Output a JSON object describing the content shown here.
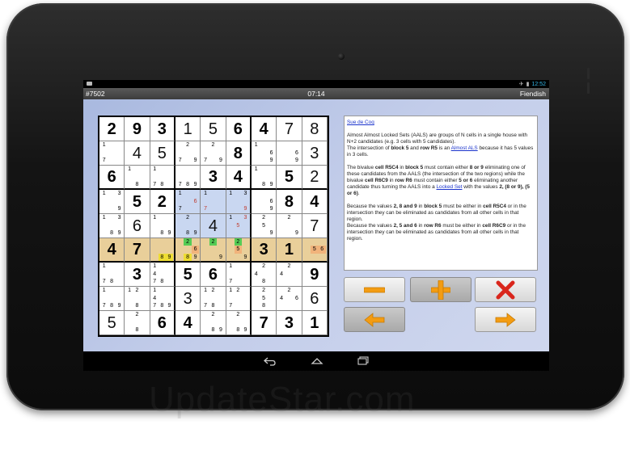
{
  "status_bar": {
    "time": "12:52"
  },
  "title_bar": {
    "puzzle_number": "#7502",
    "timer": "07:14",
    "difficulty": "Fiendish"
  },
  "board": [
    [
      "2",
      "9",
      "3",
      "1",
      "5",
      "6",
      "4",
      "7",
      "8"
    ],
    [
      "",
      "4",
      "5",
      "",
      "",
      "8",
      "",
      "",
      "3"
    ],
    [
      "6",
      "",
      "",
      "",
      "3",
      "4",
      "",
      "5",
      "2"
    ],
    [
      "",
      "5",
      "2",
      "",
      "",
      "",
      "",
      "8",
      "4"
    ],
    [
      "",
      "6",
      "",
      "",
      "4",
      "",
      "",
      "",
      "7"
    ],
    [
      "4",
      "7",
      "",
      "",
      "",
      "",
      "3",
      "1",
      ""
    ],
    [
      "",
      "3",
      "",
      "5",
      "6",
      "",
      "",
      "",
      "9"
    ],
    [
      "",
      "",
      "",
      "3",
      "",
      "",
      "",
      "",
      "6"
    ],
    [
      "5",
      "",
      "6",
      "4",
      "",
      "",
      "7",
      "3",
      "1"
    ]
  ],
  "givens": [
    [
      true,
      true,
      true,
      false,
      false,
      true,
      true,
      false,
      false
    ],
    [
      false,
      false,
      false,
      false,
      false,
      true,
      false,
      false,
      false
    ],
    [
      true,
      false,
      false,
      false,
      true,
      true,
      false,
      true,
      false
    ],
    [
      false,
      true,
      true,
      false,
      false,
      false,
      false,
      true,
      true
    ],
    [
      false,
      false,
      false,
      false,
      false,
      false,
      false,
      false,
      false
    ],
    [
      true,
      true,
      false,
      false,
      false,
      false,
      true,
      true,
      false
    ],
    [
      false,
      true,
      false,
      true,
      true,
      false,
      false,
      false,
      true
    ],
    [
      false,
      false,
      false,
      false,
      false,
      false,
      false,
      false,
      false
    ],
    [
      false,
      false,
      true,
      true,
      false,
      false,
      true,
      true,
      true
    ]
  ],
  "candidates": [
    [
      [],
      [],
      [],
      [],
      [],
      [],
      [],
      [],
      []
    ],
    [
      [
        "1",
        "",
        "",
        "",
        "",
        "",
        "7",
        "",
        ""
      ],
      [],
      [],
      [
        "",
        "2",
        "",
        "",
        "",
        "",
        "7",
        "",
        "9"
      ],
      [
        "",
        "2",
        "",
        "",
        "",
        "",
        "7",
        "",
        "9"
      ],
      [],
      [
        "1",
        "",
        "",
        "",
        "",
        "6",
        "",
        "",
        "9"
      ],
      [
        "",
        "",
        "",
        "",
        "",
        "6",
        "",
        "",
        "9"
      ],
      []
    ],
    [
      [],
      [
        "1",
        "",
        "",
        "",
        "",
        "",
        "",
        "8",
        ""
      ],
      [
        "1",
        "",
        "",
        "",
        "",
        "",
        "7",
        "8",
        ""
      ],
      [
        "",
        "",
        "",
        "",
        "",
        "",
        "7",
        "8",
        "9"
      ],
      [],
      [],
      [
        "1",
        "",
        "",
        "",
        "",
        "",
        "",
        "8",
        "9"
      ],
      [],
      []
    ],
    [
      [
        "1",
        "",
        "3",
        "",
        "",
        "",
        "",
        "",
        "9"
      ],
      [],
      [],
      [
        "1",
        "",
        "",
        "",
        "",
        "6",
        "7",
        "",
        ""
      ],
      [
        "1",
        "",
        "",
        "",
        "",
        "",
        "7",
        "",
        ""
      ],
      [
        "1",
        "",
        "3",
        "",
        "",
        "",
        "",
        "",
        "9"
      ],
      [
        "",
        "",
        "",
        "",
        "",
        "6",
        "",
        "",
        "9"
      ],
      [],
      []
    ],
    [
      [
        "1",
        "",
        "3",
        "",
        "",
        "",
        "",
        "8",
        "9"
      ],
      [],
      [
        "1",
        "",
        "",
        "",
        "",
        "",
        "",
        "8",
        "9"
      ],
      [
        "",
        "2",
        "",
        "",
        "",
        "",
        "",
        "8",
        "9"
      ],
      [],
      [
        "1",
        "",
        "3",
        "",
        "5",
        "",
        "",
        "",
        ""
      ],
      [
        "",
        "2",
        "",
        "",
        "5",
        "",
        "",
        "",
        "9"
      ],
      [
        "",
        "2",
        "",
        "",
        "",
        "",
        "",
        "",
        "9"
      ],
      []
    ],
    [
      [],
      [],
      [
        "",
        "",
        "",
        "",
        "",
        "",
        "",
        "8",
        "9"
      ],
      [
        "",
        "2",
        "",
        "",
        "",
        "6",
        "",
        "8",
        "9"
      ],
      [
        "",
        "2",
        "",
        "",
        "",
        "",
        "",
        "",
        "9"
      ],
      [
        "",
        "2",
        "",
        "",
        "5",
        "",
        "",
        "",
        "9"
      ],
      [],
      [],
      [
        "",
        "",
        "",
        "",
        "5",
        "6",
        "",
        "",
        ""
      ]
    ],
    [
      [
        "1",
        "",
        "",
        "",
        "",
        "",
        "7",
        "8",
        ""
      ],
      [],
      [
        "1",
        "",
        "",
        "4",
        "",
        "",
        "7",
        "8",
        ""
      ],
      [],
      [],
      [
        "1",
        "",
        "",
        "",
        "",
        "",
        "7",
        "",
        ""
      ],
      [
        "",
        "2",
        "",
        "4",
        "",
        "",
        "",
        "8",
        ""
      ],
      [
        "",
        "2",
        "",
        "4",
        "",
        "",
        "",
        "",
        ""
      ],
      []
    ],
    [
      [
        "1",
        "",
        "",
        "",
        "",
        "",
        "7",
        "8",
        "9"
      ],
      [
        "1",
        "2",
        "",
        "",
        "",
        "",
        "",
        "8",
        ""
      ],
      [
        "1",
        "",
        "",
        "4",
        "",
        "",
        "7",
        "8",
        "9"
      ],
      [],
      [
        "1",
        "2",
        "",
        "",
        "",
        "",
        "7",
        "8",
        ""
      ],
      [
        "1",
        "2",
        "",
        "",
        "",
        "",
        "7",
        "",
        ""
      ],
      [
        "",
        "2",
        "",
        "",
        "5",
        "",
        "",
        "8",
        ""
      ],
      [
        "",
        "2",
        "",
        "4",
        "",
        "6",
        "",
        "",
        ""
      ],
      []
    ],
    [
      [],
      [
        "",
        "2",
        "",
        "",
        "",
        "",
        "",
        "8",
        ""
      ],
      [],
      [],
      [
        "",
        "2",
        "",
        "",
        "",
        "",
        "",
        "8",
        "9"
      ],
      [
        "",
        "2",
        "",
        "",
        "",
        "",
        "",
        "8",
        "9"
      ],
      [],
      [],
      []
    ]
  ],
  "explanation": {
    "technique_link": "Sue de Coq",
    "p1_text_a": "Almost Almost Locked Sets (AALS) are groups of N cells in a single house with N+2 candidates (e.g. 3 cells with 5 candidates).",
    "p1_text_b": "The intersection of",
    "p1_bold_1": "block 5",
    "p1_text_c": "and",
    "p1_bold_2": "row R5",
    "p1_text_d": "is an",
    "p1_link": "Almost ALS",
    "p1_text_e": "because it has 5 values in 3 cells.",
    "p2_a": "The bivalue",
    "p2_b": "cell R5C4",
    "p2_c": "in",
    "p2_d": "block 5",
    "p2_e": "must contain either",
    "p2_f": "8 or 9",
    "p2_g": "eliminating one of these candidates from the AALS (the intersection of the two regions) while the bivalue",
    "p2_h": "cell R6C9",
    "p2_i": "in",
    "p2_j": "row R6",
    "p2_k": "must contain either",
    "p2_l": "5 or 6",
    "p2_m": "eliminating another candidate thus turning the AALS into a",
    "p2_link": "Locked Set",
    "p2_n": "with the values",
    "p2_o": "2, (8 or 9), (5 or 6)",
    "p3_a": "Because the values",
    "p3_b": "2, 8 and 9",
    "p3_c": "in",
    "p3_d": "block 5",
    "p3_e": "must be either in",
    "p3_f": "cell R5C4",
    "p3_g": "or in the intersection they can be eliminated as candidates from all other cells in that region.",
    "p4_a": "Because the values",
    "p4_b": "2, 5 and 6",
    "p4_c": "in",
    "p4_d": "row R6",
    "p4_e": "must be either in",
    "p4_f": "cell R6C9",
    "p4_g": "or in the intersection they can be eliminated as candidates from all other cells in that region."
  },
  "buttons": {
    "minus": "minus-icon",
    "plus": "plus-icon",
    "clear": "x-icon",
    "back": "left-arrow-icon",
    "forward": "right-arrow-icon"
  },
  "colors": {
    "candidate_highlight_green": "#55cc55",
    "candidate_highlight_yellow": "#eedd33",
    "candidate_highlight_orange": "#f1b37b",
    "row_highlight": "#e9cf9a",
    "block_highlight": "#c9d7f1",
    "eliminated": "#c0392b",
    "accent_orange": "#f39c12",
    "accent_red": "#d9261c"
  },
  "watermark": "UpdateStar.com"
}
